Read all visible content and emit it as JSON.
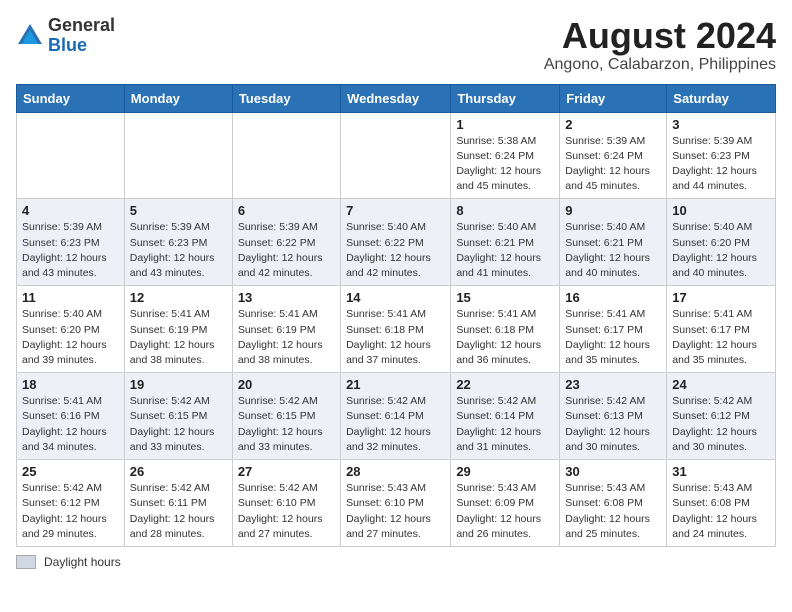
{
  "header": {
    "logo_line1": "General",
    "logo_line2": "Blue",
    "title": "August 2024",
    "subtitle": "Angono, Calabarzon, Philippines"
  },
  "footer": {
    "daylight_label": "Daylight hours"
  },
  "weekdays": [
    "Sunday",
    "Monday",
    "Tuesday",
    "Wednesday",
    "Thursday",
    "Friday",
    "Saturday"
  ],
  "weeks": [
    [
      {
        "day": "",
        "info": ""
      },
      {
        "day": "",
        "info": ""
      },
      {
        "day": "",
        "info": ""
      },
      {
        "day": "",
        "info": ""
      },
      {
        "day": "1",
        "info": "Sunrise: 5:38 AM\nSunset: 6:24 PM\nDaylight: 12 hours\nand 45 minutes."
      },
      {
        "day": "2",
        "info": "Sunrise: 5:39 AM\nSunset: 6:24 PM\nDaylight: 12 hours\nand 45 minutes."
      },
      {
        "day": "3",
        "info": "Sunrise: 5:39 AM\nSunset: 6:23 PM\nDaylight: 12 hours\nand 44 minutes."
      }
    ],
    [
      {
        "day": "4",
        "info": "Sunrise: 5:39 AM\nSunset: 6:23 PM\nDaylight: 12 hours\nand 43 minutes."
      },
      {
        "day": "5",
        "info": "Sunrise: 5:39 AM\nSunset: 6:23 PM\nDaylight: 12 hours\nand 43 minutes."
      },
      {
        "day": "6",
        "info": "Sunrise: 5:39 AM\nSunset: 6:22 PM\nDaylight: 12 hours\nand 42 minutes."
      },
      {
        "day": "7",
        "info": "Sunrise: 5:40 AM\nSunset: 6:22 PM\nDaylight: 12 hours\nand 42 minutes."
      },
      {
        "day": "8",
        "info": "Sunrise: 5:40 AM\nSunset: 6:21 PM\nDaylight: 12 hours\nand 41 minutes."
      },
      {
        "day": "9",
        "info": "Sunrise: 5:40 AM\nSunset: 6:21 PM\nDaylight: 12 hours\nand 40 minutes."
      },
      {
        "day": "10",
        "info": "Sunrise: 5:40 AM\nSunset: 6:20 PM\nDaylight: 12 hours\nand 40 minutes."
      }
    ],
    [
      {
        "day": "11",
        "info": "Sunrise: 5:40 AM\nSunset: 6:20 PM\nDaylight: 12 hours\nand 39 minutes."
      },
      {
        "day": "12",
        "info": "Sunrise: 5:41 AM\nSunset: 6:19 PM\nDaylight: 12 hours\nand 38 minutes."
      },
      {
        "day": "13",
        "info": "Sunrise: 5:41 AM\nSunset: 6:19 PM\nDaylight: 12 hours\nand 38 minutes."
      },
      {
        "day": "14",
        "info": "Sunrise: 5:41 AM\nSunset: 6:18 PM\nDaylight: 12 hours\nand 37 minutes."
      },
      {
        "day": "15",
        "info": "Sunrise: 5:41 AM\nSunset: 6:18 PM\nDaylight: 12 hours\nand 36 minutes."
      },
      {
        "day": "16",
        "info": "Sunrise: 5:41 AM\nSunset: 6:17 PM\nDaylight: 12 hours\nand 35 minutes."
      },
      {
        "day": "17",
        "info": "Sunrise: 5:41 AM\nSunset: 6:17 PM\nDaylight: 12 hours\nand 35 minutes."
      }
    ],
    [
      {
        "day": "18",
        "info": "Sunrise: 5:41 AM\nSunset: 6:16 PM\nDaylight: 12 hours\nand 34 minutes."
      },
      {
        "day": "19",
        "info": "Sunrise: 5:42 AM\nSunset: 6:15 PM\nDaylight: 12 hours\nand 33 minutes."
      },
      {
        "day": "20",
        "info": "Sunrise: 5:42 AM\nSunset: 6:15 PM\nDaylight: 12 hours\nand 33 minutes."
      },
      {
        "day": "21",
        "info": "Sunrise: 5:42 AM\nSunset: 6:14 PM\nDaylight: 12 hours\nand 32 minutes."
      },
      {
        "day": "22",
        "info": "Sunrise: 5:42 AM\nSunset: 6:14 PM\nDaylight: 12 hours\nand 31 minutes."
      },
      {
        "day": "23",
        "info": "Sunrise: 5:42 AM\nSunset: 6:13 PM\nDaylight: 12 hours\nand 30 minutes."
      },
      {
        "day": "24",
        "info": "Sunrise: 5:42 AM\nSunset: 6:12 PM\nDaylight: 12 hours\nand 30 minutes."
      }
    ],
    [
      {
        "day": "25",
        "info": "Sunrise: 5:42 AM\nSunset: 6:12 PM\nDaylight: 12 hours\nand 29 minutes."
      },
      {
        "day": "26",
        "info": "Sunrise: 5:42 AM\nSunset: 6:11 PM\nDaylight: 12 hours\nand 28 minutes."
      },
      {
        "day": "27",
        "info": "Sunrise: 5:42 AM\nSunset: 6:10 PM\nDaylight: 12 hours\nand 27 minutes."
      },
      {
        "day": "28",
        "info": "Sunrise: 5:43 AM\nSunset: 6:10 PM\nDaylight: 12 hours\nand 27 minutes."
      },
      {
        "day": "29",
        "info": "Sunrise: 5:43 AM\nSunset: 6:09 PM\nDaylight: 12 hours\nand 26 minutes."
      },
      {
        "day": "30",
        "info": "Sunrise: 5:43 AM\nSunset: 6:08 PM\nDaylight: 12 hours\nand 25 minutes."
      },
      {
        "day": "31",
        "info": "Sunrise: 5:43 AM\nSunset: 6:08 PM\nDaylight: 12 hours\nand 24 minutes."
      }
    ]
  ]
}
